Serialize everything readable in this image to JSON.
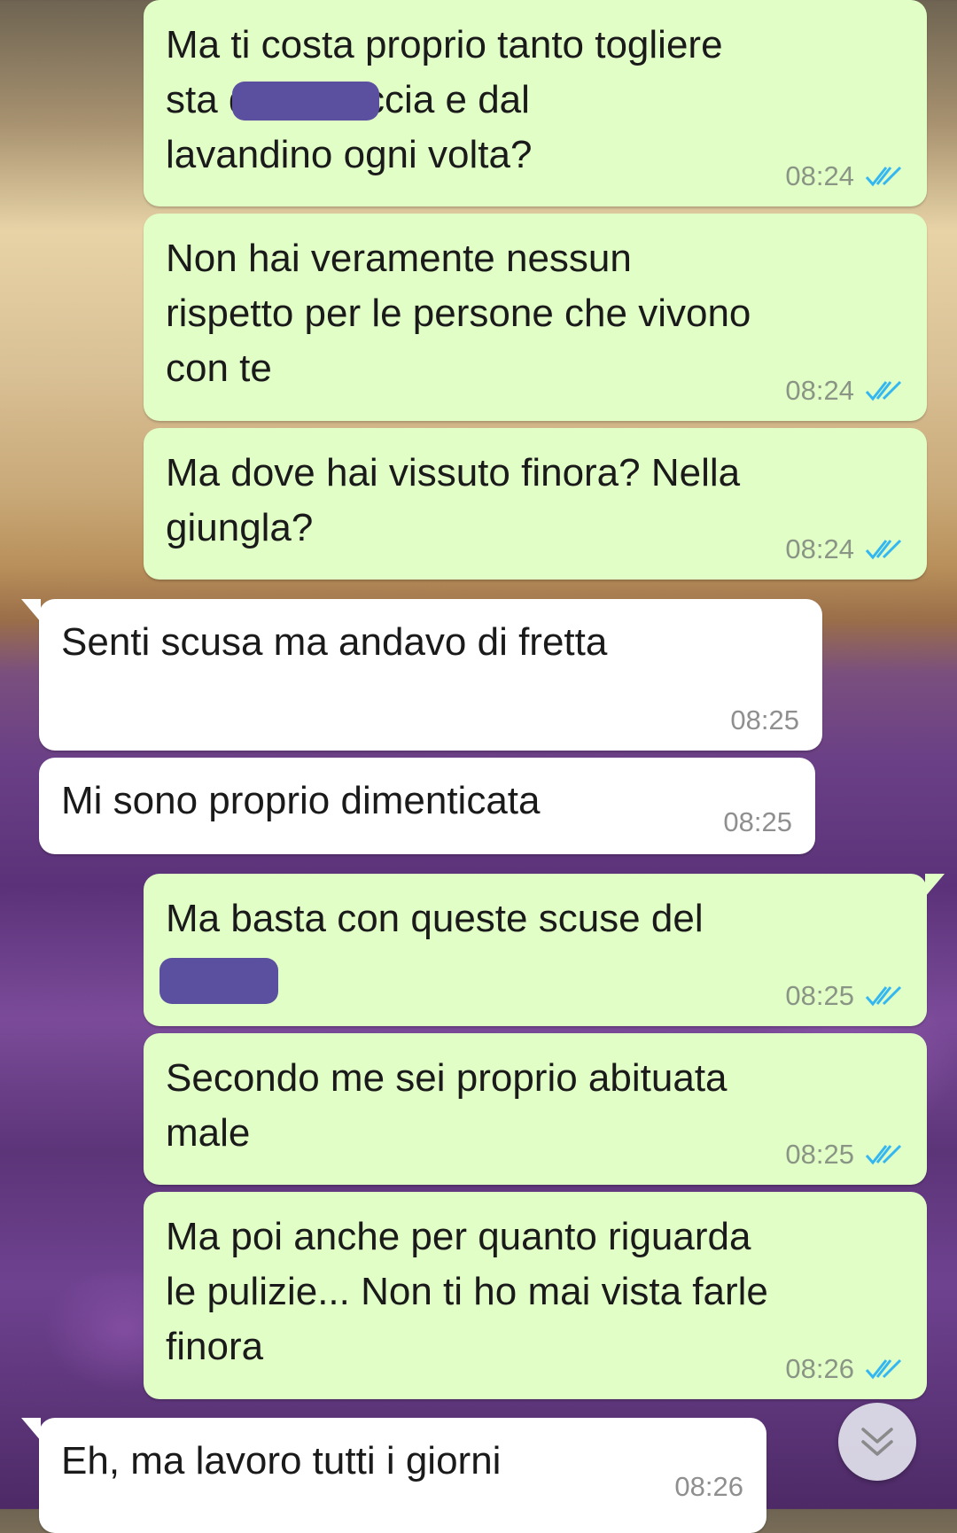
{
  "messages": [
    {
      "direction": "out",
      "text": "Ma ti costa proprio tanto togliere\nsta                  dalla doccia e dal\nlavandino ogni volta?",
      "time": "08:24",
      "status": "read"
    },
    {
      "direction": "out",
      "text": "Non hai veramente nessun\nrispetto per le persone che vivono\ncon te",
      "time": "08:24",
      "status": "read"
    },
    {
      "direction": "out",
      "text": "Ma dove hai vissuto finora? Nella\ngiungla?",
      "time": "08:24",
      "status": "read"
    },
    {
      "direction": "in",
      "text": "Senti scusa ma andavo di fretta",
      "time": "08:25"
    },
    {
      "direction": "in",
      "text": "Mi sono proprio dimenticata",
      "time": "08:25"
    },
    {
      "direction": "out",
      "text": "Ma basta con queste scuse del\n                 o!",
      "time": "08:25",
      "status": "read"
    },
    {
      "direction": "out",
      "text": "Secondo me sei proprio abituata\nmale",
      "time": "08:25",
      "status": "read"
    },
    {
      "direction": "out",
      "text": "Ma poi anche per quanto riguarda\nle pulizie... Non ti ho mai vista farle\nfinora",
      "time": "08:26",
      "status": "read"
    },
    {
      "direction": "in",
      "text": "Eh, ma lavoro tutti i giorni",
      "time": "08:26"
    }
  ],
  "colors": {
    "outgoing_bubble": "#e1fec6",
    "incoming_bubble": "#ffffff",
    "read_ticks": "#34b7f1",
    "redaction": "#5b50a0"
  },
  "scroll_button": {
    "icon": "chevron-double-down-icon"
  }
}
